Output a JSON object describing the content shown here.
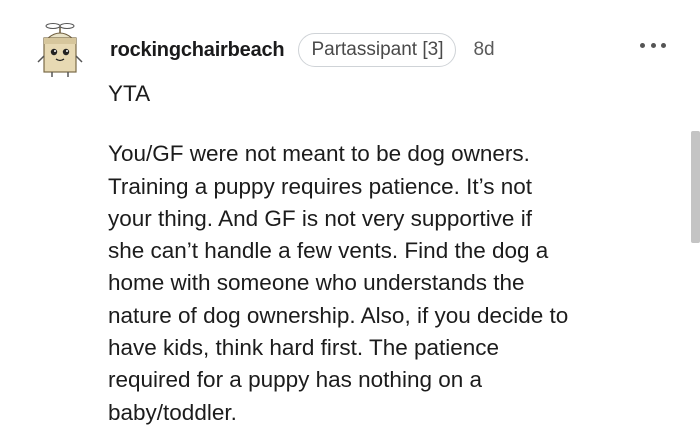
{
  "comment": {
    "username": "rockingchairbeach",
    "flair": "Partassipant [3]",
    "time": "8d",
    "more_icon": "more-horizontal-icon",
    "paragraphs": [
      {
        "lines": [
          "YTA"
        ]
      },
      {
        "lines": [
          "You/GF were not meant to be dog owners.",
          "Training a puppy requires patience. It’s not",
          "your thing. And GF is not very supportive if",
          "she can’t handle a few vents. Find the dog a",
          "home with someone who understands the",
          "nature of dog ownership. Also, if you decide to",
          "have kids, think hard first. The patience",
          "required for a puppy has nothing on a",
          "baby/toddler."
        ]
      }
    ]
  },
  "colors": {
    "text": "#1c1c1c",
    "meta": "#5a5a5a",
    "flair_border": "#cfd3d7",
    "scrollbar": "#c4c4c4"
  }
}
